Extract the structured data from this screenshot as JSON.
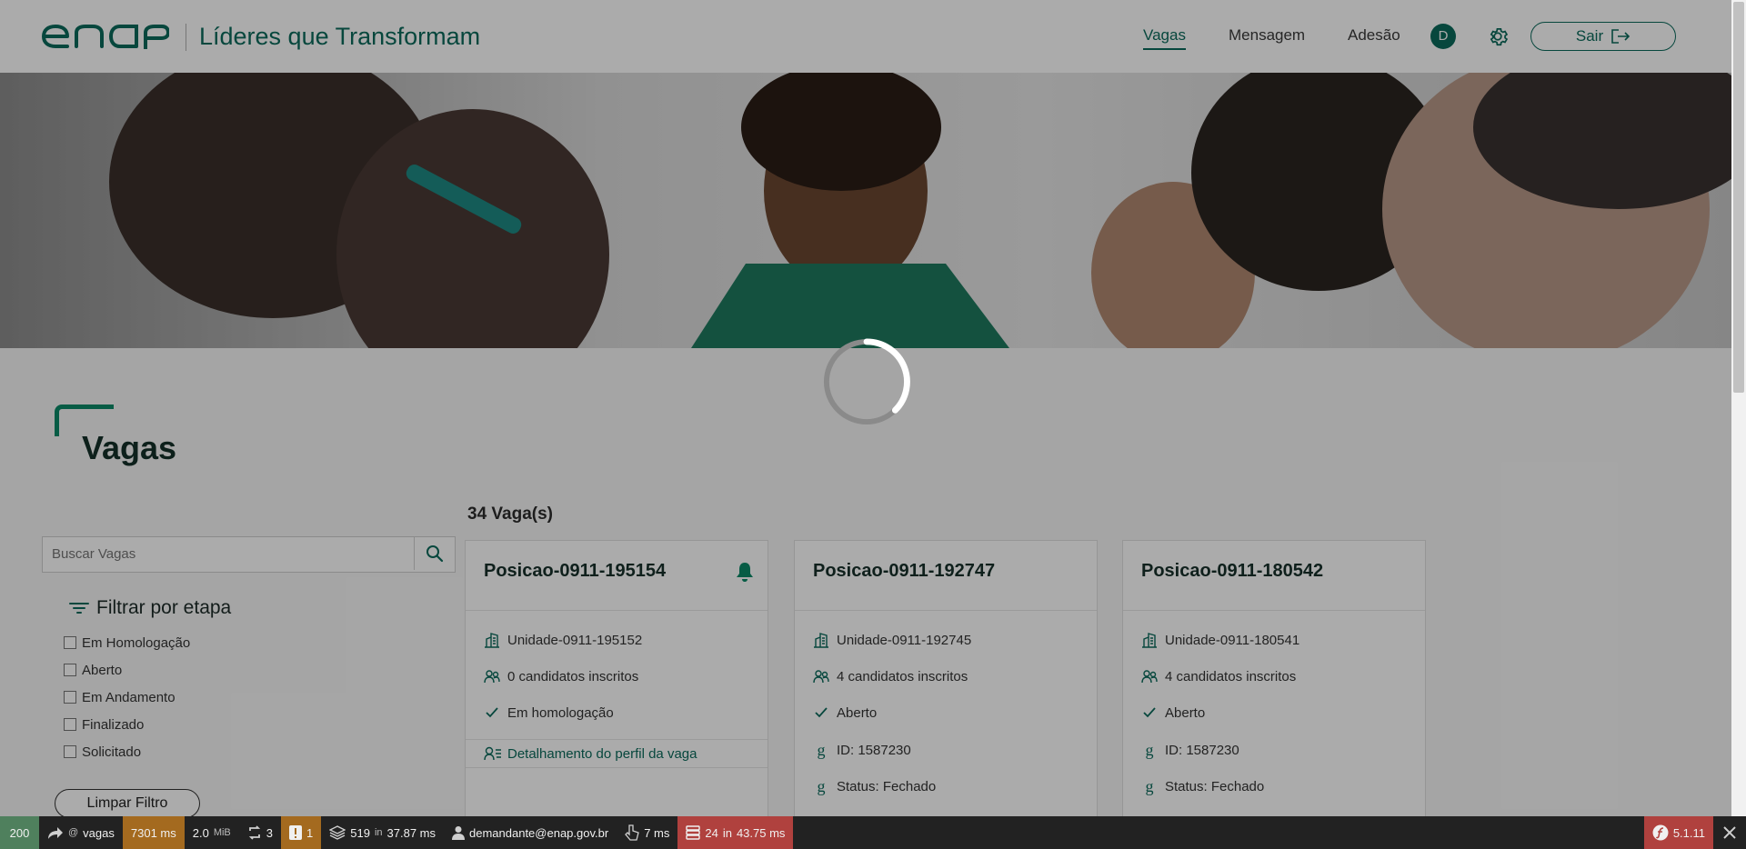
{
  "header": {
    "brand_title": "Líderes que Transformam",
    "nav": [
      {
        "label": "Vagas"
      },
      {
        "label": "Mensagem"
      },
      {
        "label": "Adesão"
      }
    ],
    "avatar_initial": "D",
    "logout_label": "Sair"
  },
  "page": {
    "title": "Vagas",
    "results_count": "34 Vaga(s)"
  },
  "sidebar": {
    "search_placeholder": "Buscar Vagas",
    "filter_title": "Filtrar por etapa",
    "filters": [
      {
        "label": "Em Homologação",
        "checked": false
      },
      {
        "label": "Aberto",
        "checked": false
      },
      {
        "label": "Em Andamento",
        "checked": false
      },
      {
        "label": "Finalizado",
        "checked": false
      },
      {
        "label": "Solicitado",
        "checked": false
      }
    ],
    "clear_label": "Limpar Filtro"
  },
  "cards": [
    {
      "title": "Posicao-0911-195154",
      "unit": "Unidade-0911-195152",
      "candidates": "0 candidatos inscritos",
      "status": "Em homologação",
      "detail_link": "Detalhamento do perfil da vaga"
    },
    {
      "title": "Posicao-0911-192747",
      "unit": "Unidade-0911-192745",
      "candidates": "4 candidatos inscritos",
      "status": "Aberto",
      "id_text": "ID: 1587230",
      "status_text": "Status: Fechado"
    },
    {
      "title": "Posicao-0911-180542",
      "unit": "Unidade-0911-180541",
      "candidates": "4 candidatos inscritos",
      "status": "Aberto",
      "id_text": "ID: 1587230",
      "status_text": "Status: Fechado"
    }
  ],
  "debug_toolbar": {
    "status_code": "200",
    "route": "vagas",
    "time": "7301 ms",
    "memory_value": "2.0",
    "memory_unit": "MiB",
    "requests": "3",
    "warnings": "1",
    "templates_count": "519",
    "templates_time": "37.87 ms",
    "user": "demandante@enap.gov.br",
    "event_time": "7 ms",
    "db_queries": "24",
    "db_time": "43.75 ms",
    "symfony_version": "5.1.11",
    "in_word": "in"
  },
  "colors": {
    "brand": "#0b6b5c",
    "accent": "#0b8a68",
    "toolbar_bg": "#222222",
    "toolbar_green": "#4f805d",
    "toolbar_amber": "#a46a1f",
    "toolbar_red": "#b0413e"
  }
}
